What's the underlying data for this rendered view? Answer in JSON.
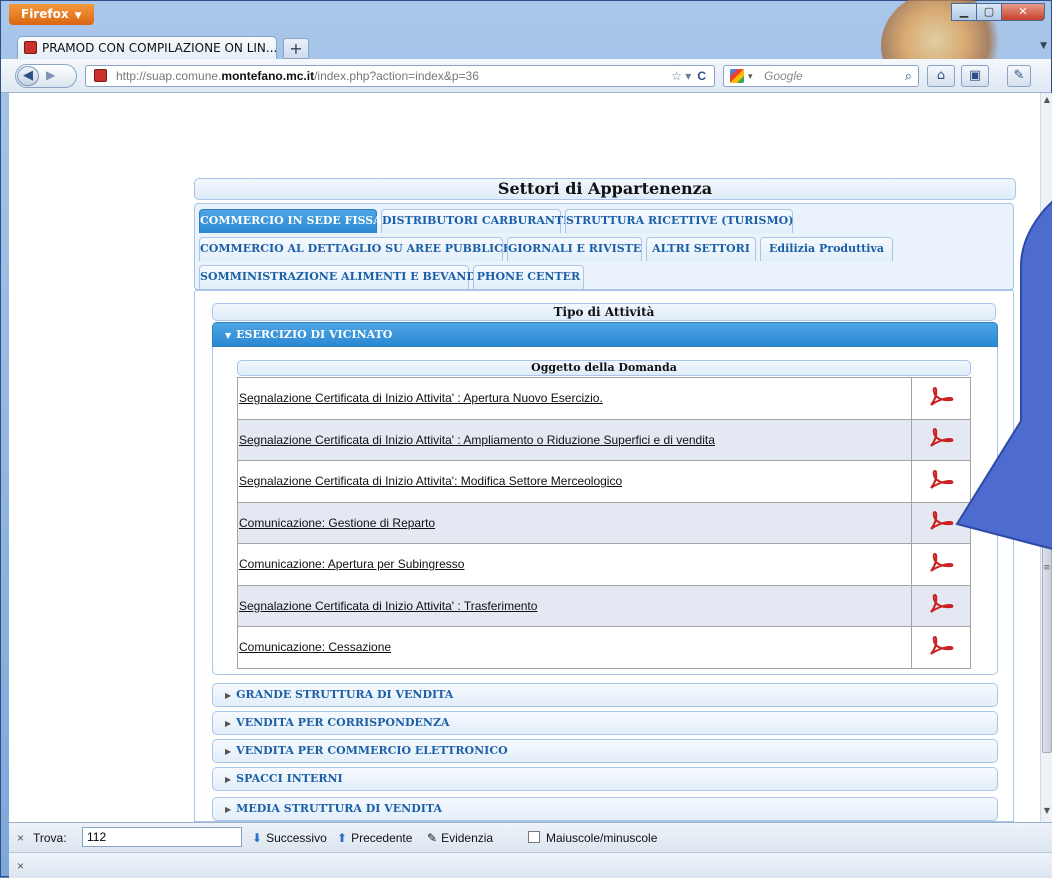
{
  "browser": {
    "app_button": "Firefox",
    "tab_title": "PRAMOD CON COMPILAZIONE ON LIN...",
    "url_prefix": "http://suap.comune.",
    "url_domain": "montefano.mc.it",
    "url_suffix": "/index.php?action=index&p=36",
    "search_placeholder": "Google"
  },
  "page": {
    "title": "Settori di Appartenenza",
    "sector_tabs": [
      {
        "label": "COMMERCIO IN SEDE FISSA",
        "active": true
      },
      {
        "label": "DISTRIBUTORI CARBURANTI"
      },
      {
        "label": "STRUTTURA RICETTIVE (TURISMO)"
      },
      {
        "label": "COMMERCIO AL DETTAGLIO SU AREE PUBBLICHE"
      },
      {
        "label": "GIORNALI E RIVISTE"
      },
      {
        "label": "ALTRI SETTORI"
      },
      {
        "label": "Edilizia Produttiva"
      },
      {
        "label": "SOMMINISTRAZIONE ALIMENTI E BEVANDE"
      },
      {
        "label": "PHONE CENTER"
      }
    ],
    "tipo_header": "Tipo di Attività",
    "active_section": "ESERCIZIO DI VICINATO",
    "oggetto_header": "Oggetto della Domanda",
    "documents": [
      "Segnalazione Certificata di Inizio Attivita' : Apertura Nuovo Esercizio.",
      "Segnalazione Certificata di Inizio Attivita' : Ampliamento o Riduzione Superfici e di vendita",
      "Segnalazione Certificata di Inizio Attivita': Modifica Settore Merceologico",
      "Comunicazione: Gestione di Reparto",
      "Comunicazione: Apertura per Subingresso",
      "Segnalazione Certificata di Inizio Attivita' : Trasferimento",
      "Comunicazione: Cessazione"
    ],
    "other_sections": [
      "GRANDE STRUTTURA DI VENDITA",
      "VENDITA PER CORRISPONDENZA",
      "VENDITA PER COMMERCIO ELETTRONICO",
      "SPACCI INTERNI",
      "MEDIA STRUTTURA DI VENDITA"
    ]
  },
  "findbar": {
    "close": "×",
    "label": "Trova:",
    "value": "112",
    "next": "Successivo",
    "prev": "Precedente",
    "highlight": "Evidenzia",
    "match_case": "Maiuscole/minuscole"
  },
  "statusbar": {
    "close": "×"
  },
  "colors": {
    "accent": "#2b89d2",
    "callout": "#4e6bd0"
  }
}
